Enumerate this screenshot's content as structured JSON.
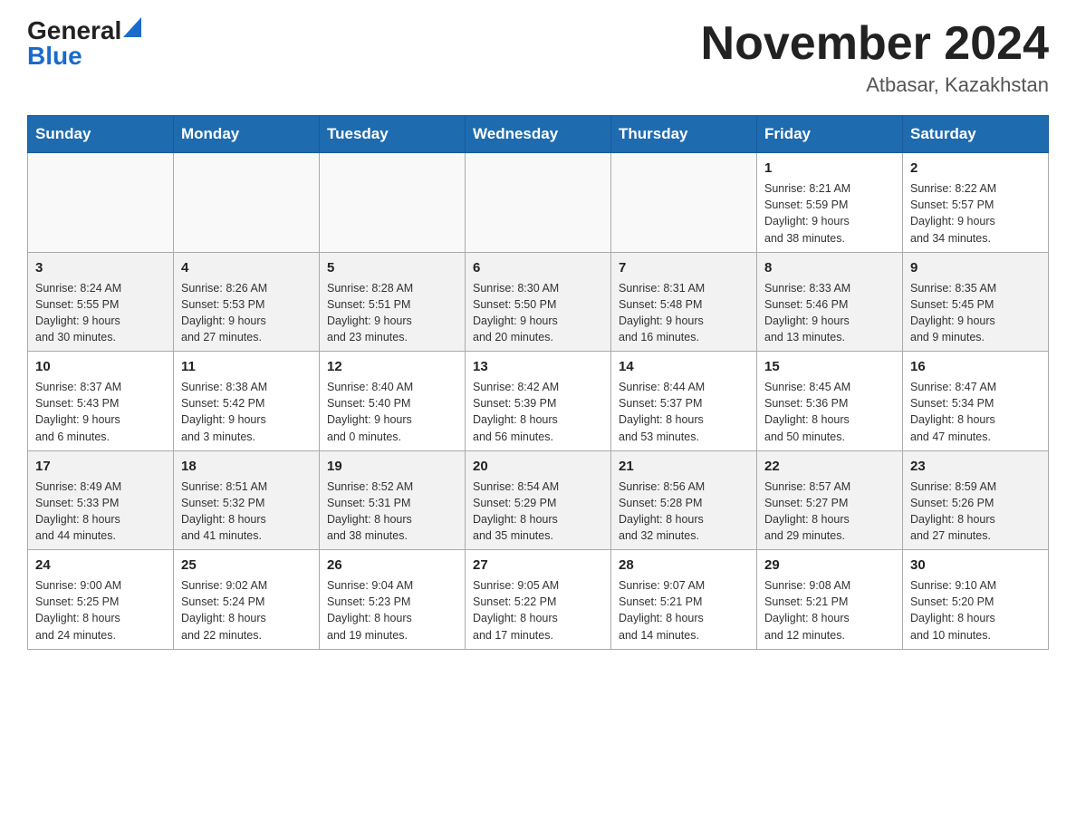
{
  "header": {
    "logo_general": "General",
    "logo_blue": "Blue",
    "month_title": "November 2024",
    "location": "Atbasar, Kazakhstan"
  },
  "days_of_week": [
    "Sunday",
    "Monday",
    "Tuesday",
    "Wednesday",
    "Thursday",
    "Friday",
    "Saturday"
  ],
  "weeks": [
    {
      "days": [
        {
          "number": "",
          "info": ""
        },
        {
          "number": "",
          "info": ""
        },
        {
          "number": "",
          "info": ""
        },
        {
          "number": "",
          "info": ""
        },
        {
          "number": "",
          "info": ""
        },
        {
          "number": "1",
          "info": "Sunrise: 8:21 AM\nSunset: 5:59 PM\nDaylight: 9 hours\nand 38 minutes."
        },
        {
          "number": "2",
          "info": "Sunrise: 8:22 AM\nSunset: 5:57 PM\nDaylight: 9 hours\nand 34 minutes."
        }
      ]
    },
    {
      "days": [
        {
          "number": "3",
          "info": "Sunrise: 8:24 AM\nSunset: 5:55 PM\nDaylight: 9 hours\nand 30 minutes."
        },
        {
          "number": "4",
          "info": "Sunrise: 8:26 AM\nSunset: 5:53 PM\nDaylight: 9 hours\nand 27 minutes."
        },
        {
          "number": "5",
          "info": "Sunrise: 8:28 AM\nSunset: 5:51 PM\nDaylight: 9 hours\nand 23 minutes."
        },
        {
          "number": "6",
          "info": "Sunrise: 8:30 AM\nSunset: 5:50 PM\nDaylight: 9 hours\nand 20 minutes."
        },
        {
          "number": "7",
          "info": "Sunrise: 8:31 AM\nSunset: 5:48 PM\nDaylight: 9 hours\nand 16 minutes."
        },
        {
          "number": "8",
          "info": "Sunrise: 8:33 AM\nSunset: 5:46 PM\nDaylight: 9 hours\nand 13 minutes."
        },
        {
          "number": "9",
          "info": "Sunrise: 8:35 AM\nSunset: 5:45 PM\nDaylight: 9 hours\nand 9 minutes."
        }
      ]
    },
    {
      "days": [
        {
          "number": "10",
          "info": "Sunrise: 8:37 AM\nSunset: 5:43 PM\nDaylight: 9 hours\nand 6 minutes."
        },
        {
          "number": "11",
          "info": "Sunrise: 8:38 AM\nSunset: 5:42 PM\nDaylight: 9 hours\nand 3 minutes."
        },
        {
          "number": "12",
          "info": "Sunrise: 8:40 AM\nSunset: 5:40 PM\nDaylight: 9 hours\nand 0 minutes."
        },
        {
          "number": "13",
          "info": "Sunrise: 8:42 AM\nSunset: 5:39 PM\nDaylight: 8 hours\nand 56 minutes."
        },
        {
          "number": "14",
          "info": "Sunrise: 8:44 AM\nSunset: 5:37 PM\nDaylight: 8 hours\nand 53 minutes."
        },
        {
          "number": "15",
          "info": "Sunrise: 8:45 AM\nSunset: 5:36 PM\nDaylight: 8 hours\nand 50 minutes."
        },
        {
          "number": "16",
          "info": "Sunrise: 8:47 AM\nSunset: 5:34 PM\nDaylight: 8 hours\nand 47 minutes."
        }
      ]
    },
    {
      "days": [
        {
          "number": "17",
          "info": "Sunrise: 8:49 AM\nSunset: 5:33 PM\nDaylight: 8 hours\nand 44 minutes."
        },
        {
          "number": "18",
          "info": "Sunrise: 8:51 AM\nSunset: 5:32 PM\nDaylight: 8 hours\nand 41 minutes."
        },
        {
          "number": "19",
          "info": "Sunrise: 8:52 AM\nSunset: 5:31 PM\nDaylight: 8 hours\nand 38 minutes."
        },
        {
          "number": "20",
          "info": "Sunrise: 8:54 AM\nSunset: 5:29 PM\nDaylight: 8 hours\nand 35 minutes."
        },
        {
          "number": "21",
          "info": "Sunrise: 8:56 AM\nSunset: 5:28 PM\nDaylight: 8 hours\nand 32 minutes."
        },
        {
          "number": "22",
          "info": "Sunrise: 8:57 AM\nSunset: 5:27 PM\nDaylight: 8 hours\nand 29 minutes."
        },
        {
          "number": "23",
          "info": "Sunrise: 8:59 AM\nSunset: 5:26 PM\nDaylight: 8 hours\nand 27 minutes."
        }
      ]
    },
    {
      "days": [
        {
          "number": "24",
          "info": "Sunrise: 9:00 AM\nSunset: 5:25 PM\nDaylight: 8 hours\nand 24 minutes."
        },
        {
          "number": "25",
          "info": "Sunrise: 9:02 AM\nSunset: 5:24 PM\nDaylight: 8 hours\nand 22 minutes."
        },
        {
          "number": "26",
          "info": "Sunrise: 9:04 AM\nSunset: 5:23 PM\nDaylight: 8 hours\nand 19 minutes."
        },
        {
          "number": "27",
          "info": "Sunrise: 9:05 AM\nSunset: 5:22 PM\nDaylight: 8 hours\nand 17 minutes."
        },
        {
          "number": "28",
          "info": "Sunrise: 9:07 AM\nSunset: 5:21 PM\nDaylight: 8 hours\nand 14 minutes."
        },
        {
          "number": "29",
          "info": "Sunrise: 9:08 AM\nSunset: 5:21 PM\nDaylight: 8 hours\nand 12 minutes."
        },
        {
          "number": "30",
          "info": "Sunrise: 9:10 AM\nSunset: 5:20 PM\nDaylight: 8 hours\nand 10 minutes."
        }
      ]
    }
  ]
}
